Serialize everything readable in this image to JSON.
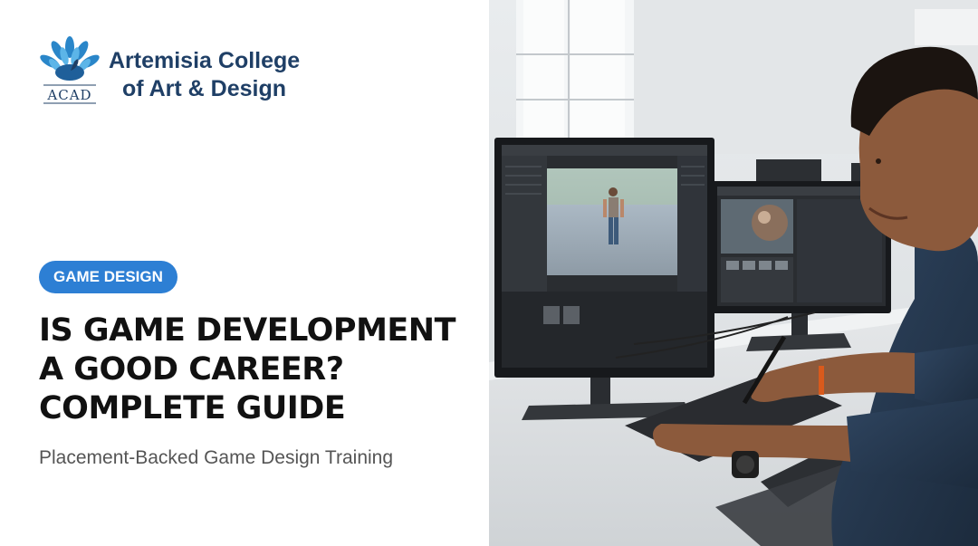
{
  "brand": {
    "name_line1": "Artemisia College",
    "name_line2": "of Art & Design",
    "logo_text": "ACAD",
    "color": "#1f3f66"
  },
  "category": {
    "label": "GAME DESIGN",
    "color": "#2d7fd4"
  },
  "headline": {
    "line1": "IS GAME DEVELOPMENT",
    "line2": "A GOOD CAREER?",
    "line3": "COMPLETE GUIDE"
  },
  "subheadline": "Placement-Backed Game Design Training",
  "photo": {
    "icon": "game-developer-photo"
  }
}
